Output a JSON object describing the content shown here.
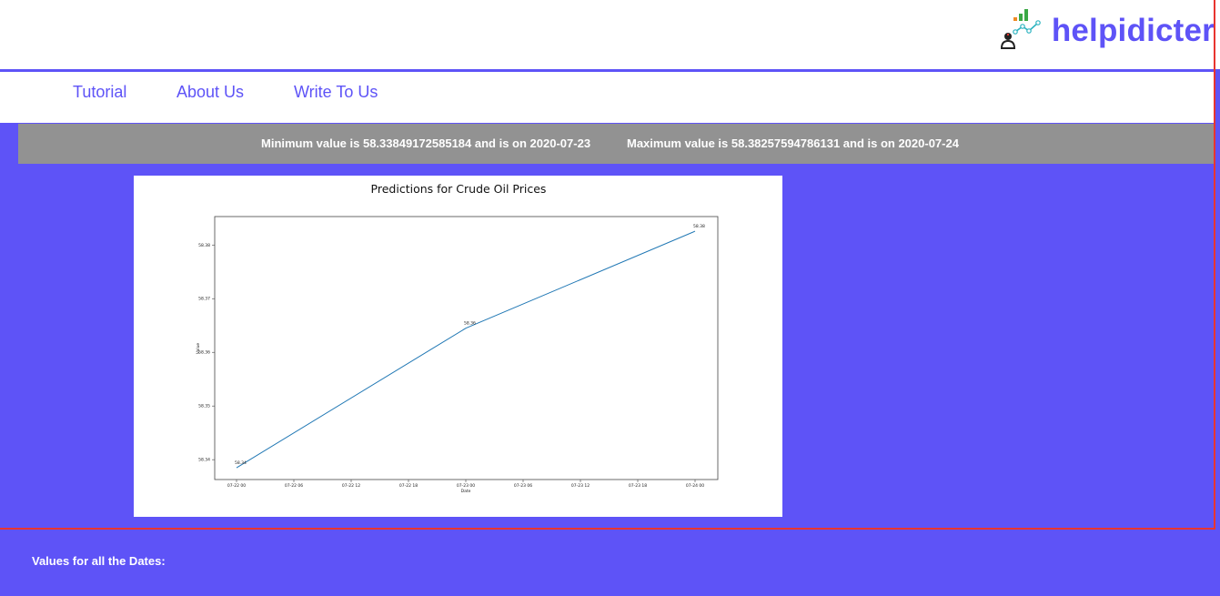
{
  "brand": {
    "name": "helpidicter",
    "logo_icon": "chart-person-icon",
    "colors": {
      "accent": "#5e53f7",
      "bar_green": "#3aa845",
      "bar_orange": "#f08a24",
      "line_teal": "#2bb3c0"
    }
  },
  "nav": {
    "items": [
      {
        "label": "Tutorial"
      },
      {
        "label": "About Us"
      },
      {
        "label": "Write To Us"
      }
    ]
  },
  "stats": {
    "minimum": "Minimum value is 58.33849172585184 and is on 2020-07-23",
    "maximum": "Maximum value is 58.38257594786131 and is on 2020-07-24"
  },
  "chart_data": {
    "type": "line",
    "title": "Predictions for Crude Oil Prices",
    "xlabel": "Date",
    "ylabel": "Value",
    "x_ticks": [
      "07-22 00",
      "07-22 06",
      "07-22 12",
      "07-22 18",
      "07-23 00",
      "07-23 06",
      "07-23 12",
      "07-23 18",
      "07-24 00"
    ],
    "y_ticks": [
      "58.34",
      "58.35",
      "58.36",
      "58.37",
      "58.38"
    ],
    "ylim": [
      58.3363,
      58.3853
    ],
    "series": [
      {
        "color": "#1f77b4",
        "points": [
          {
            "x": "2020-07-22 00:00",
            "y": 58.33849172585184
          },
          {
            "x": "2020-07-23 00:00",
            "y": 58.3645
          },
          {
            "x": "2020-07-24 00:00",
            "y": 58.38257594786131
          }
        ]
      }
    ],
    "annotations": [
      "58.34",
      "58.36",
      "58.38"
    ],
    "grid": false
  },
  "footer": {
    "label": "Values for all the Dates:"
  }
}
